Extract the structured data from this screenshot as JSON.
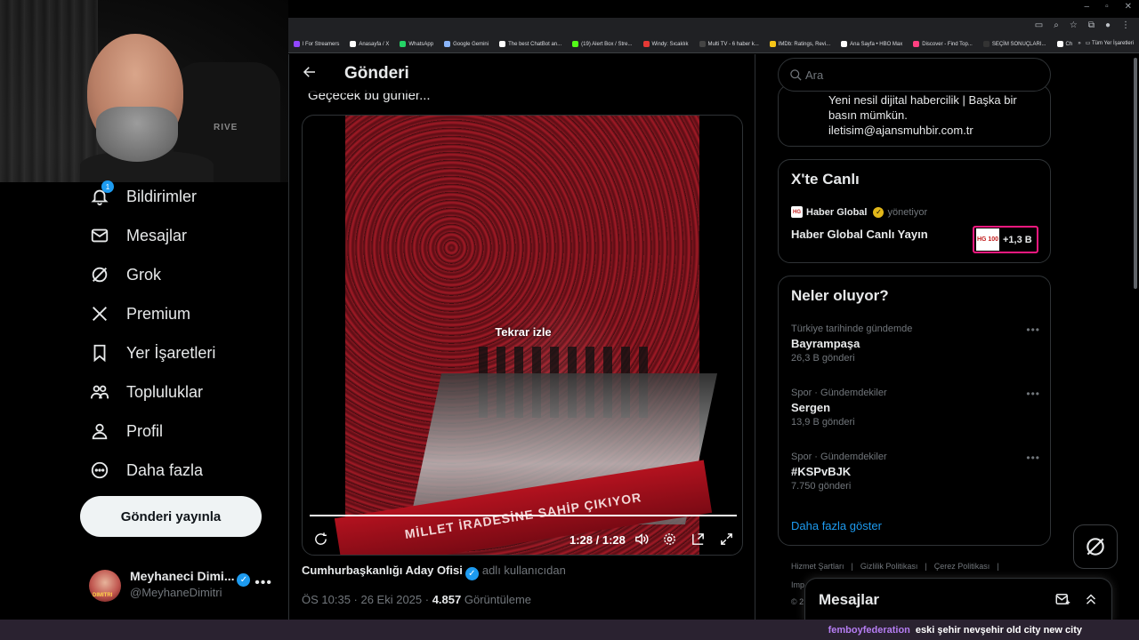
{
  "window": {
    "controls": [
      "–",
      "▫",
      "✕"
    ]
  },
  "bookmarks": [
    {
      "label": "l For Streamers",
      "color": "#9146ff"
    },
    {
      "label": "Anasayfa / X",
      "color": "#ffffff"
    },
    {
      "label": "WhatsApp",
      "color": "#25d366"
    },
    {
      "label": "Google Gemini",
      "color": "#8ab4f8"
    },
    {
      "label": "The best ChatBot an...",
      "color": "#ffffff"
    },
    {
      "label": "(19) Alert Box / Stre...",
      "color": "#53fc18"
    },
    {
      "label": "Windy: Sıcaklık",
      "color": "#e53935"
    },
    {
      "label": "Multi TV - 6 haber k...",
      "color": "#444444"
    },
    {
      "label": "IMDb: Ratings, Revi...",
      "color": "#f5c518"
    },
    {
      "label": "Ana Sayfa • HBO Max",
      "color": "#ffffff"
    },
    {
      "label": "Discover - Find Top...",
      "color": "#ff4081"
    },
    {
      "label": "SEÇİM SONUÇLARI...",
      "color": "#333333"
    },
    {
      "label": "ChatGPT",
      "color": "#ffffff"
    }
  ],
  "bookmarks_folder": "Tüm Yer İşaretleri",
  "webcam": {
    "chair_logo": "RIVE"
  },
  "nav": {
    "items": [
      {
        "label": "Bildirimler",
        "icon": "bell-icon",
        "badge": "1"
      },
      {
        "label": "Mesajlar",
        "icon": "mail-icon"
      },
      {
        "label": "Grok",
        "icon": "grok-icon"
      },
      {
        "label": "Premium",
        "icon": "x-logo-icon"
      },
      {
        "label": "Yer İşaretleri",
        "icon": "bookmark-icon"
      },
      {
        "label": "Topluluklar",
        "icon": "communities-icon"
      },
      {
        "label": "Profil",
        "icon": "person-icon"
      },
      {
        "label": "Daha fazla",
        "icon": "more-circle-icon"
      }
    ],
    "post_button": "Gönderi yayınla"
  },
  "profile": {
    "name": "Meyhaneci Dimi...",
    "handle": "@MeyhaneDimitri",
    "avatar_text": "DIMITRI"
  },
  "main": {
    "title": "Gönderi",
    "tweet_text": "Geçecek bu günler...",
    "video": {
      "overlay": "Tekrar izle",
      "time": "1:28 / 1:28",
      "progress": 1.0,
      "banner_text": "MİLLET İRADESİNE SAHİP ÇIKIYOR"
    },
    "author": "Cumhurbaşkanlığı Aday Ofisi",
    "author_suffix": "adlı kullanıcıdan",
    "time": "ÖS 10:35 · 26 Eki 2025 · ",
    "views": "4.857",
    "views_label": " Görüntüleme"
  },
  "right": {
    "search_placeholder": "Ara",
    "bio_lines": [
      "Yeni nesil dijital habercilik | Başka bir",
      "basın mümkün.",
      "iletisim@ajansmuhbir.com.tr"
    ],
    "live": {
      "title": "X'te Canlı",
      "source": "Haber Global",
      "source_suffix": "yönetiyor",
      "logo": "HG",
      "stream_title": "Haber Global Canlı Yayın",
      "count": "+1,3 B",
      "thumb": "HG 100"
    },
    "trends": {
      "title": "Neler oluyor?",
      "items": [
        {
          "context": "Türkiye tarihinde gündemde",
          "name": "Bayrampaşa",
          "count": "26,3 B gönderi"
        },
        {
          "context": "Spor · Gündemdekiler",
          "name": "Sergen",
          "count": "13,9 B gönderi"
        },
        {
          "context": "Spor · Gündemdekiler",
          "name": "#KSPvBJK",
          "count": "7.750 gönderi"
        }
      ],
      "show_more": "Daha fazla göster"
    },
    "footer": [
      "Hizmet Şartları",
      "Gizlilik Politikası",
      "Çerez Politikası"
    ],
    "footer_more": "Imp",
    "footer_copy": "© 2"
  },
  "messages_drawer": {
    "title": "Mesajlar"
  },
  "ticker": {
    "user": "femboyfederation",
    "message": "eski şehir nevşehir old city new city"
  }
}
